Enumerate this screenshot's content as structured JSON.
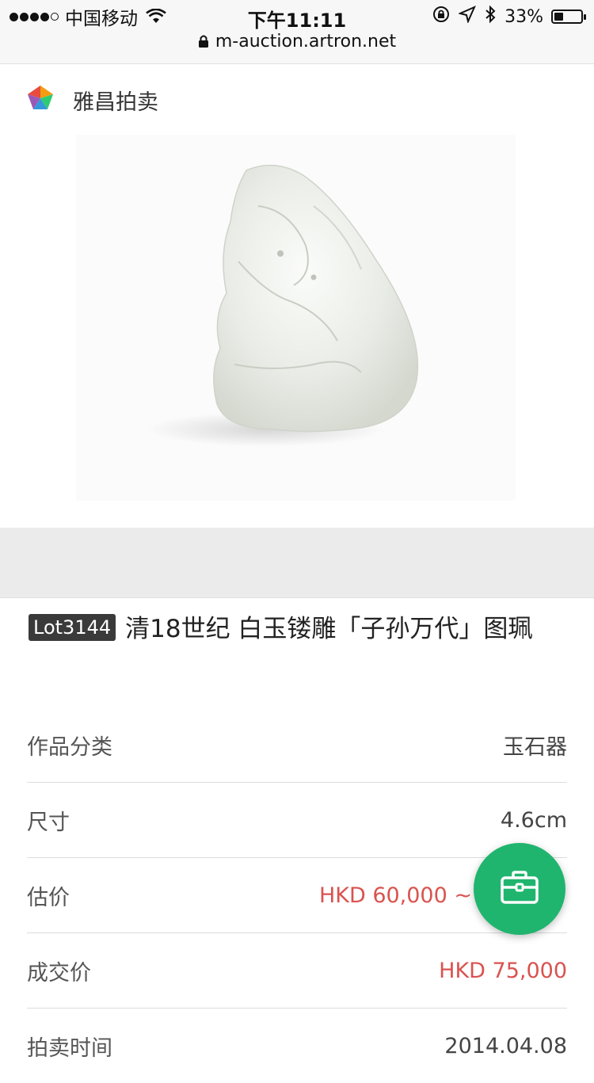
{
  "status_bar": {
    "carrier": "中国移动",
    "time": "下午11:11",
    "battery": "33%",
    "battery_level": 0.33
  },
  "url": "m-auction.artron.net",
  "brand": {
    "name": "雅昌拍卖"
  },
  "lot": {
    "badge": "Lot3144",
    "title": "清18世纪 白玉镂雕「子孙万代」图珮"
  },
  "details": [
    {
      "label": "作品分类",
      "value": "玉石器"
    },
    {
      "label": "尺寸",
      "value": "4.6cm"
    },
    {
      "label": "估价",
      "value": "HKD 60,000 ~"
    },
    {
      "label": "成交价",
      "value": "HKD 75,000"
    },
    {
      "label": "拍卖时间",
      "value": "2014.04.08"
    }
  ],
  "colors": {
    "accent_green": "#1fb56e",
    "price_red": "#d9534f"
  }
}
